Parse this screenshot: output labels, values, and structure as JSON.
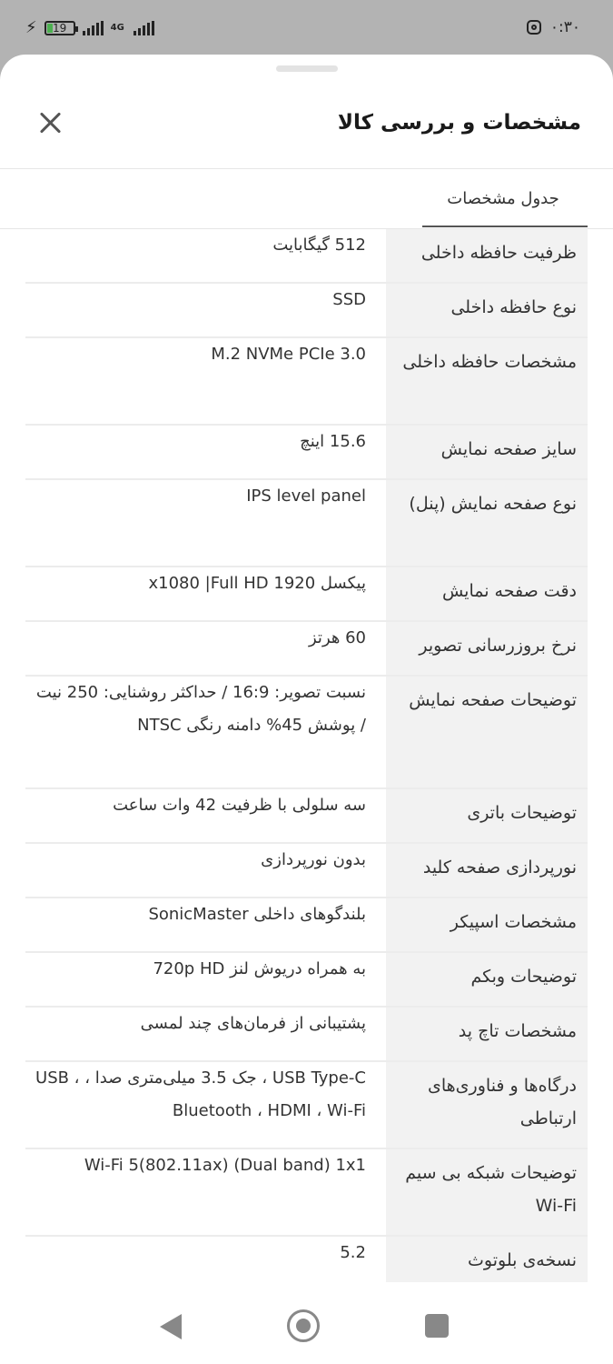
{
  "status_bar": {
    "battery": "19",
    "network": "4G",
    "time": "۰:۳۰"
  },
  "header": {
    "title": "مشخصات و بررسی کالا"
  },
  "tabs": [
    {
      "label": "جدول مشخصات",
      "active": true
    }
  ],
  "specs": [
    {
      "key": "ظرفیت حافظه داخلی",
      "value": "512 گیگابایت"
    },
    {
      "key": "نوع حافظه داخلی",
      "value": "SSD"
    },
    {
      "key": "مشخصات حافظه داخلی",
      "value": "M.2 NVMe PCIe 3.0"
    },
    {
      "key": "سایز صفحه نمایش",
      "value": "15.6 اینچ"
    },
    {
      "key": "نوع صفحه نمایش (پنل)",
      "value": "IPS level panel"
    },
    {
      "key": "دقت صفحه نمایش",
      "value": "پیکسل 1920 x1080 |Full HD"
    },
    {
      "key": "نرخ بروزرسانی تصویر",
      "value": "60 هرتز"
    },
    {
      "key": "توضیحات صفحه نمایش",
      "value": "نسبت تصویر: 16:9 / حداکثر روشنایی: 250 نیت / پوشش 45% دامنه رنگی NTSC"
    },
    {
      "key": "توضیحات باتری",
      "value": "سه سلولی با ظرفیت 42 وات ساعت"
    },
    {
      "key": "نورپردازی صفحه کلید",
      "value": "بدون نورپردازی"
    },
    {
      "key": "مشخصات اسپیکر",
      "value": "بلندگوهای داخلی SonicMaster"
    },
    {
      "key": "توضیحات وبکم",
      "value": "به همراه دریوش لنز 720p HD"
    },
    {
      "key": "مشخصات تاچ پد",
      "value": "پشتیبانی از فرمان‌های چند لمسی"
    },
    {
      "key": "درگاه‌ها و فناوری‌های ارتباطی",
      "value": "USB Type-C ، جک 3.5 میلی‌متری صدا ، USB ، Bluetooth ، HDMI ، Wi-Fi"
    },
    {
      "key": "توضیحات شبکه بی سیم Wi-Fi",
      "value": "Wi-Fi 5(802.11ax) (Dual band) 1x1"
    },
    {
      "key": "نسخه‌ی بلوتوث",
      "value": "5.2"
    }
  ]
}
